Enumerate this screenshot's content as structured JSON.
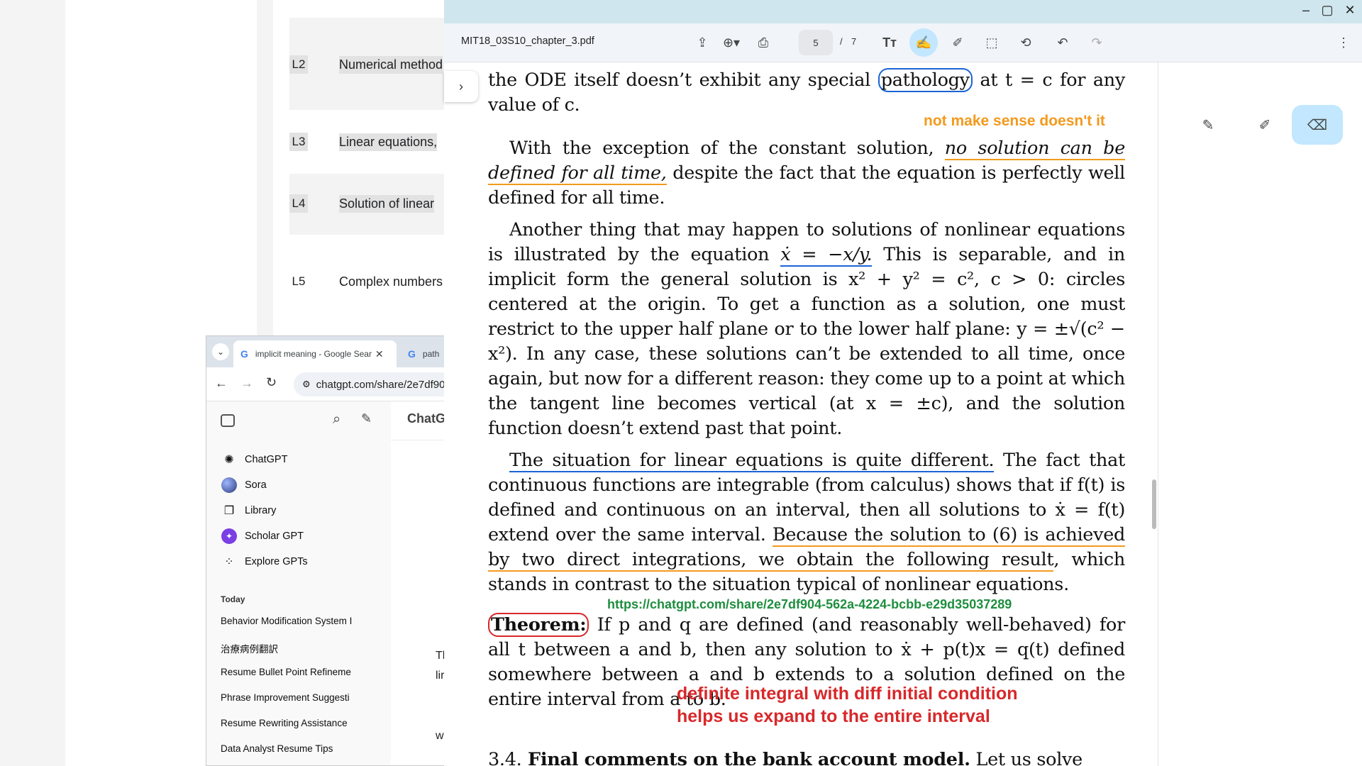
{
  "course_list": [
    {
      "code": "L2",
      "title": "Numerical method"
    },
    {
      "code": "L3",
      "title": "Linear equations,"
    },
    {
      "code": "L4",
      "title": "Solution of linear"
    },
    {
      "code": "L5",
      "title": "Complex numbers"
    }
  ],
  "browser": {
    "tabs": [
      {
        "label": "implicit meaning - Google Sear",
        "icon": "google-icon"
      },
      {
        "label": "path",
        "icon": "google-icon"
      }
    ],
    "url": "chatgpt.com/share/2e7df90",
    "app_title": "ChatG",
    "sidebar": {
      "items": [
        "ChatGPT",
        "Sora",
        "Library",
        "Scholar GPT",
        "Explore GPTs"
      ],
      "today_label": "Today",
      "history": [
        "Behavior Modification System I",
        "治療病例翻訳",
        "Resume Bullet Point Refineme",
        "Phrase Improvement Suggesti",
        "Resume Rewriting Assistance",
        "Data Analyst Resume Tips"
      ]
    },
    "content_peek": [
      "Th",
      "lir",
      "w"
    ]
  },
  "pdf": {
    "filename": "MIT18_03S10_chapter_3.pdf",
    "page_current": "5",
    "page_total": "7",
    "page_sep": "/",
    "p1_a": "the ODE itself doesn’t exhibit any special ",
    "p1_circle": "pathology",
    "p1_b": " at t = c for any value of c.",
    "p2_a": "With the exception of the constant solution, ",
    "p2_ul": "no solution can be defined for all time,",
    "p2_b": " despite the fact that the equation is perfectly well defined for all time.",
    "p3_a": "Another thing that may happen to solutions of nonlinear equations is illustrated by the equation ",
    "p3_ul": "ẋ = −x/y.",
    "p3_b": " This is separable, and in implicit form the general solution is x² + y² = c², c > 0: circles centered at the origin. To get a function as a solution, one must restrict to the upper half plane or to the lower half plane: y = ±√(c² − x²). In any case, these solutions can’t be extended to all time, once again, but now for a different reason: they come up to a point at which the tangent line becomes vertical (at x = ±c), and the solution function doesn’t extend past that point.",
    "p4_ul": "The situation for linear equations is quite different.",
    "p4_a": " The fact that continuous functions are integrable (from calculus) shows that if f(t) is defined and continuous on an interval, then all solutions to ẋ = f(t) extend over the same interval. ",
    "p4_ul2": "Because the solution to (6) is achieved by two direct integrations, we obtain the following result",
    "p4_b": ", which stands in contrast to the situation typical of nonlinear equations.",
    "thm_label": "Theorem:",
    "thm_text": " If p and q are defined (and reasonably well-behaved) for all t between a and b, then any solution to ẋ + p(t)x = q(t) defined somewhere between a and b extends to a solution defined on the entire interval from a to b.",
    "sec_num": "3.4.",
    "sec_title": " Final comments on the bank account model.",
    "sec_text": " Let us solve",
    "note_orange": "not make sense doesn't it",
    "note_green": "https://chatgpt.com/share/2e7df904-562a-4224-bcbb-e29d35037289",
    "note_red_1": "definite integral with diff initial condition",
    "note_red_2": "helps us expand to the entire interval",
    "colors": {
      "orange": "#f29a1e",
      "green": "#1e8e3e",
      "red": "#d8282a",
      "blue": "#1a64d6"
    }
  }
}
